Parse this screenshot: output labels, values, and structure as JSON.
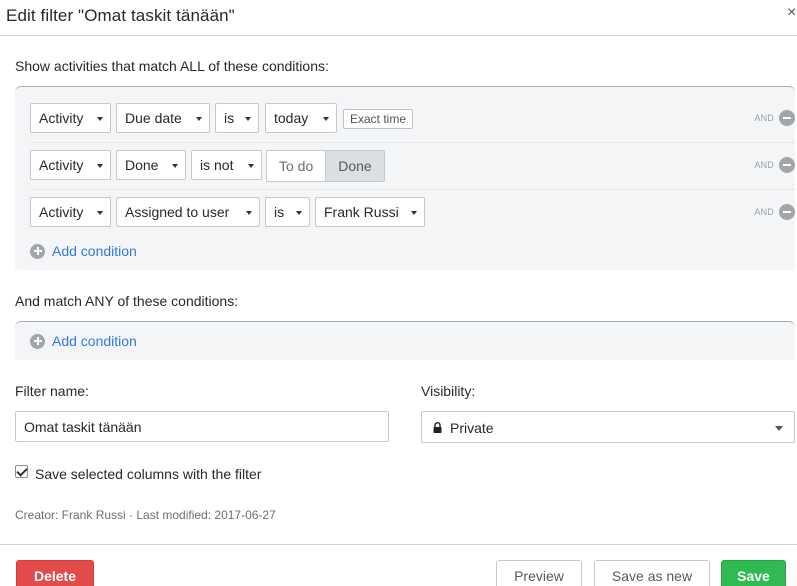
{
  "dialog": {
    "title": "Edit filter \"Omat taskit tänään\"",
    "close_glyph": "×"
  },
  "all_section": {
    "label": "Show activities that match ALL of these conditions:",
    "conditions": [
      {
        "entity": "Activity",
        "field": "Due date",
        "operator": "is",
        "value": "today",
        "extra_button": "Exact time",
        "joiner": "AND"
      },
      {
        "entity": "Activity",
        "field": "Done",
        "operator": "is not",
        "toggle_options": [
          "To do",
          "Done"
        ],
        "toggle_selected": "Done",
        "joiner": "AND"
      },
      {
        "entity": "Activity",
        "field": "Assigned to user",
        "operator": "is",
        "value": "Frank Russi",
        "joiner": "AND"
      }
    ],
    "add_label": "Add condition"
  },
  "any_section": {
    "label": "And match ANY of these conditions:",
    "add_label": "Add condition"
  },
  "filter_name": {
    "label": "Filter name:",
    "value": "Omat taskit tänään"
  },
  "visibility": {
    "label": "Visibility:",
    "value": "Private",
    "icon": "lock-icon"
  },
  "save_columns": {
    "checked": true,
    "label": "Save selected columns with the filter"
  },
  "meta": {
    "text": "Creator: Frank Russi · Last modified: 2017-06-27"
  },
  "buttons": {
    "delete": "Delete",
    "preview": "Preview",
    "save_as_new": "Save as new",
    "save": "Save"
  },
  "colors": {
    "link": "#317ae2",
    "delete": "#e34b4b",
    "save": "#2fba52",
    "panel_bg": "#f4f5f6"
  }
}
